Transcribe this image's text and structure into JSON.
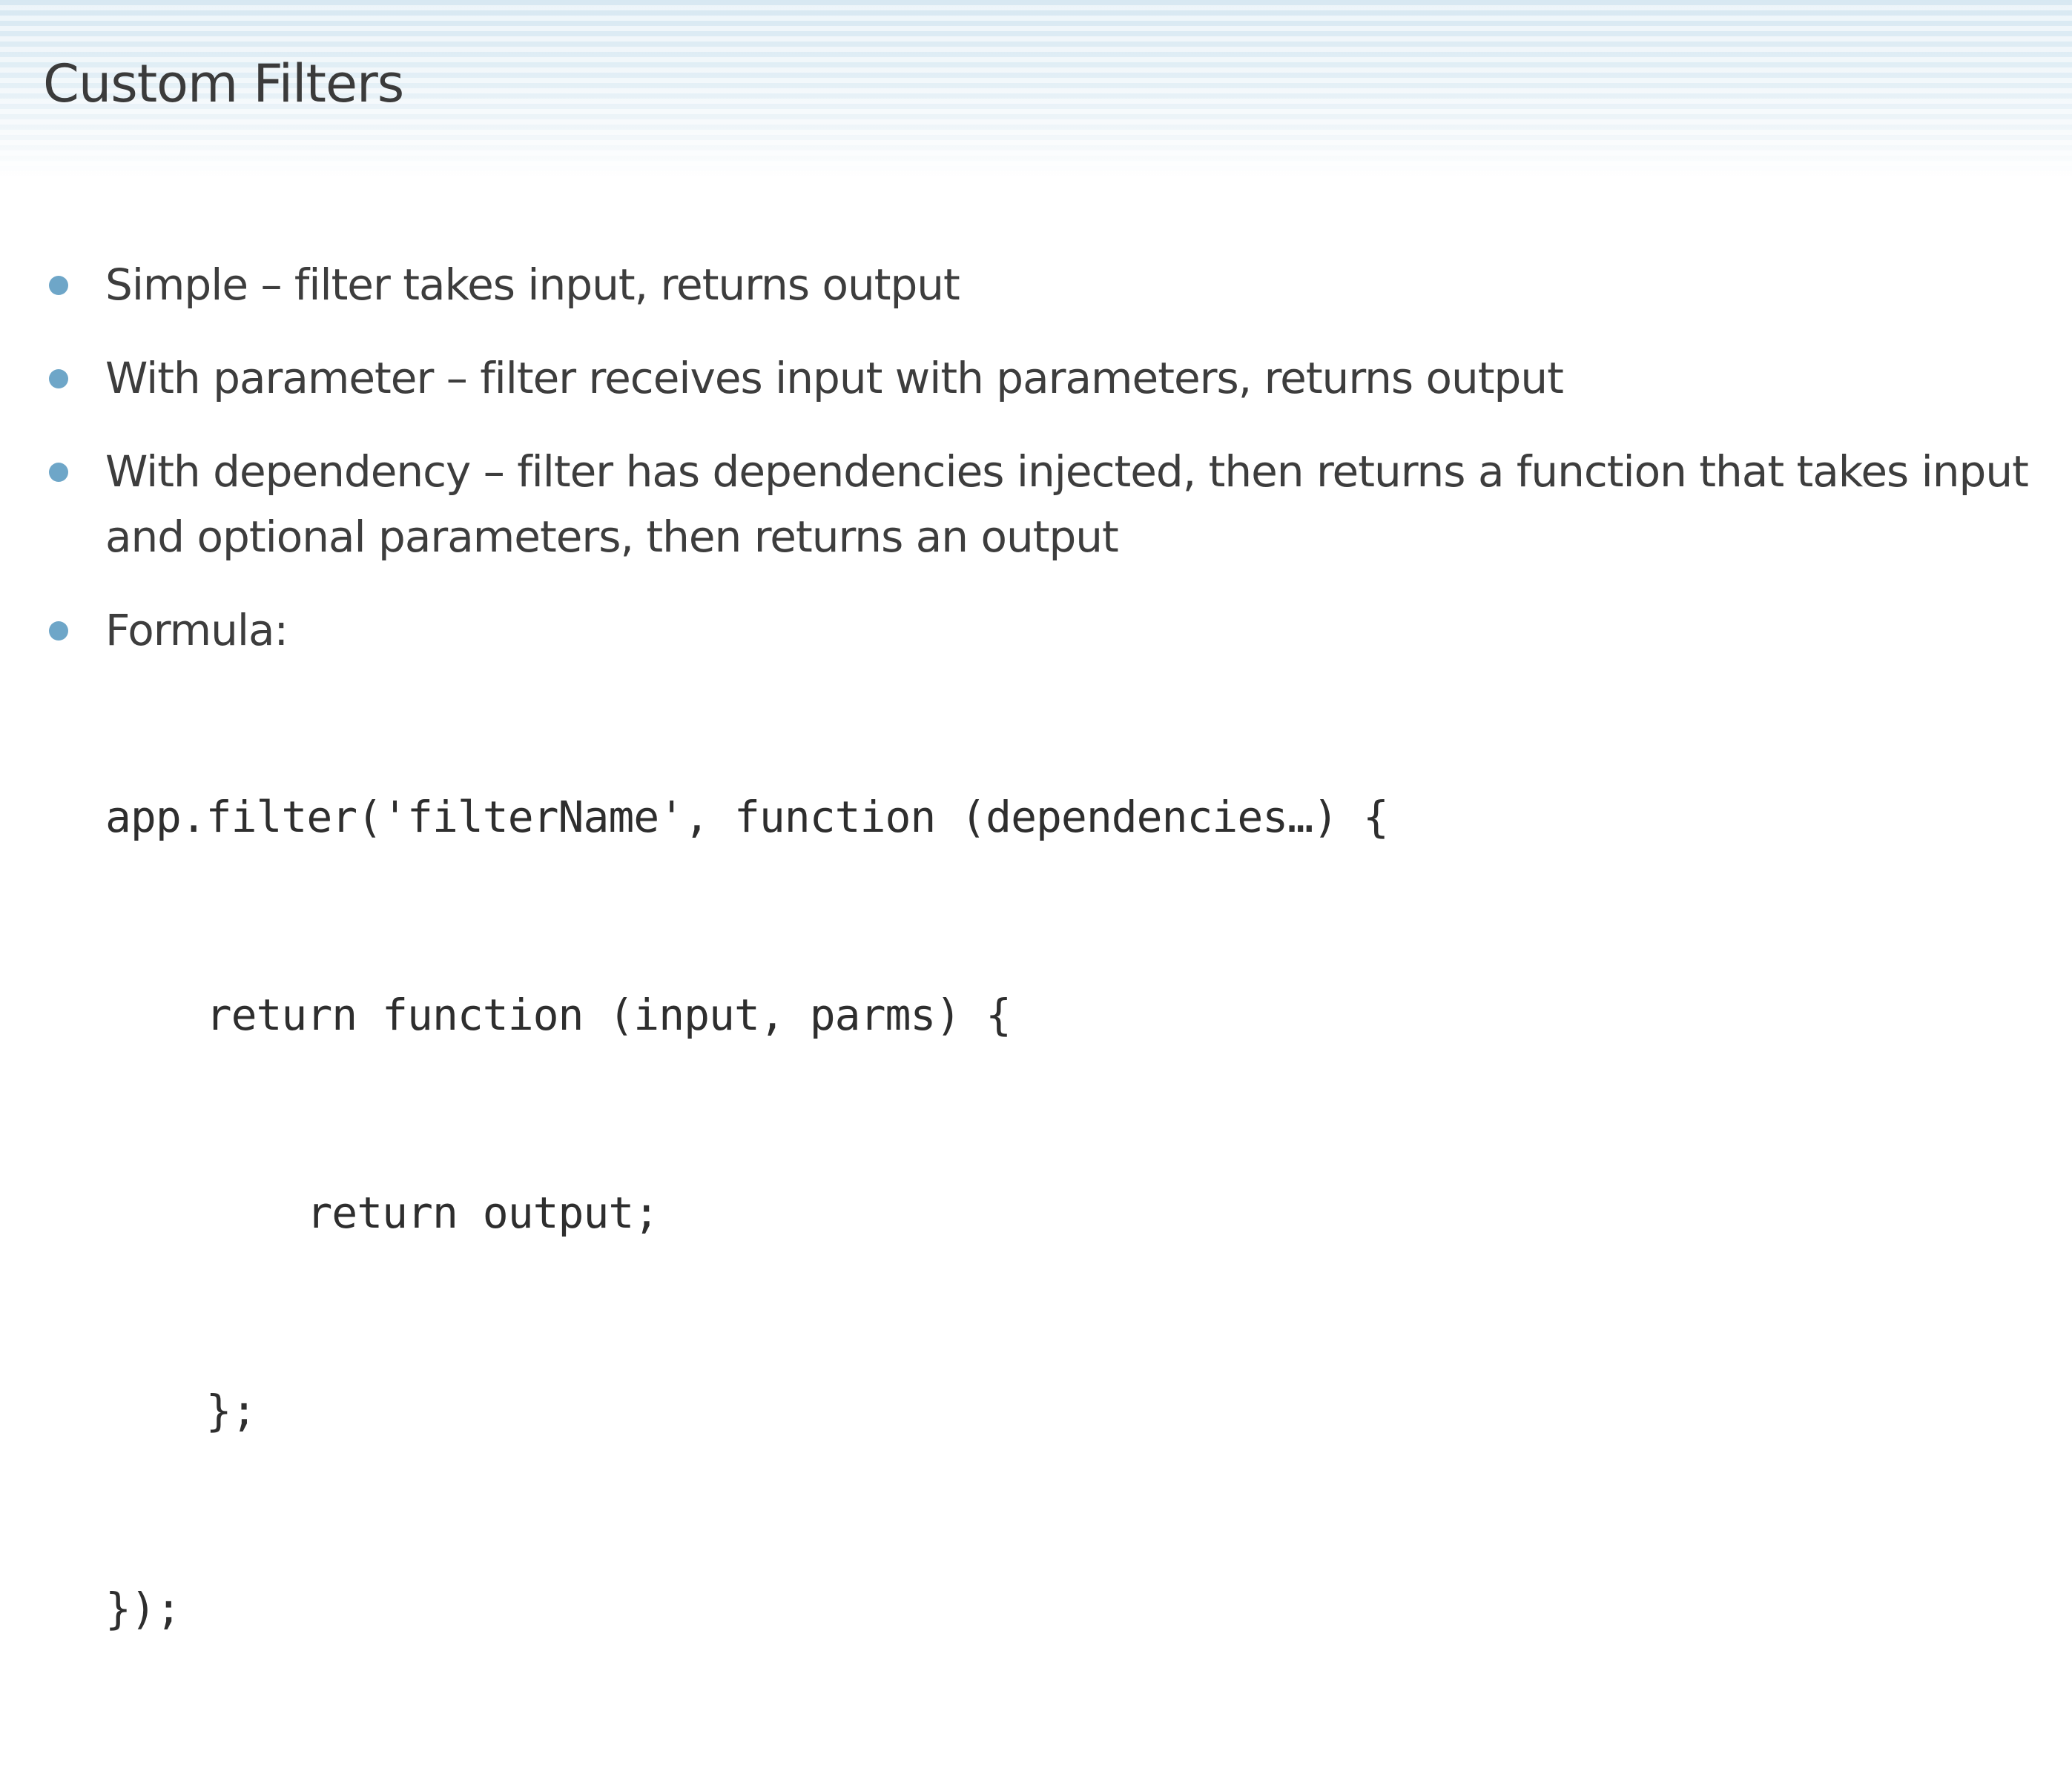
{
  "slide": {
    "title": "Custom Filters",
    "bullets": [
      {
        "text": "Simple – filter takes input, returns output"
      },
      {
        "text": "With parameter – filter receives input with parameters, returns output"
      },
      {
        "text": "With dependency – filter has dependencies injected, then returns a function that takes input and optional parameters, then returns an output"
      },
      {
        "text": "Formula:"
      }
    ],
    "code": [
      "app.filter('filterName', function (dependencies…) {",
      "    return function (input, parms) {",
      "        return output;",
      "    };",
      "});"
    ]
  },
  "colors": {
    "bullet_dot": "#6ea6c8",
    "title_band": "#d7e8f2",
    "text": "#3d3d3d"
  }
}
